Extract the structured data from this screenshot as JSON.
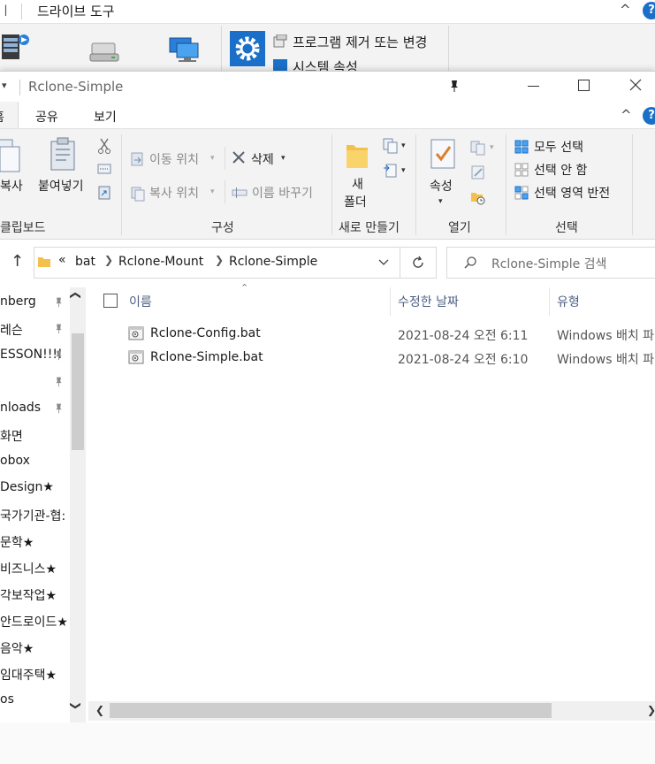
{
  "bg_window": {
    "partial_tab": "ㅣ",
    "tab_drive_tools": "드라이브 도구",
    "chevron": "^",
    "help": "?",
    "program_remove": "프로그램 제거 또는 변경",
    "system_props": "시스템 속성"
  },
  "window": {
    "title": "Rclone-Simple",
    "pin": "📌",
    "minimize": "—",
    "maximize": "☐",
    "close": "✕"
  },
  "menu": {
    "tab_home_partial": "홈",
    "tab_share": "공유",
    "tab_view": "보기",
    "collapse": "^",
    "help": "?"
  },
  "ribbon": {
    "paste_partial": "복사",
    "paste": "붙여넣기",
    "clipboard_label": "클립보드",
    "move_to": "이동 위치",
    "copy_to": "복사 위치",
    "delete": "삭제",
    "rename": "이름 바꾸기",
    "organize_label": "구성",
    "new_folder_line1": "새",
    "new_folder_line2": "폴더",
    "new_label": "새로 만들기",
    "properties": "속성",
    "open_label": "열기",
    "select_all": "모두 선택",
    "select_none": "선택 안 함",
    "invert_selection": "선택 영역 반전",
    "select_label": "선택"
  },
  "address": {
    "back": "↑",
    "overflow": "«",
    "crumbs": [
      "bat",
      "Rclone-Mount",
      "Rclone-Simple"
    ],
    "search_placeholder": "Rclone-Simple 검색"
  },
  "nav_items": [
    {
      "label": "nberg",
      "pinned": true
    },
    {
      "label": "레슨",
      "pinned": true
    },
    {
      "label": "ESSON!!!!",
      "pinned": true
    },
    {
      "label": "",
      "pinned": true
    },
    {
      "label": "nloads",
      "pinned": true
    },
    {
      "label": "화면",
      "pinned": false
    },
    {
      "label": "obox",
      "pinned": false
    },
    {
      "label": "Design★",
      "pinned": false
    },
    {
      "label": "국가기관-협:",
      "pinned": false
    },
    {
      "label": "문학★",
      "pinned": false
    },
    {
      "label": "비즈니스★",
      "pinned": false
    },
    {
      "label": "각보작업★",
      "pinned": false
    },
    {
      "label": "안드로이드★",
      "pinned": false
    },
    {
      "label": "음악★",
      "pinned": false
    },
    {
      "label": "임대주택★",
      "pinned": false
    },
    {
      "label": "os",
      "pinned": false
    }
  ],
  "columns": {
    "name": "이름",
    "modified": "수정한 날짜",
    "type": "유형"
  },
  "files": [
    {
      "name": "Rclone-Config.bat",
      "modified": "2021-08-24 오전 6:11",
      "type": "Windows 배치 파"
    },
    {
      "name": "Rclone-Simple.bat",
      "modified": "2021-08-24 오전 6:10",
      "type": "Windows 배치 파"
    }
  ],
  "colors": {
    "accent": "#0078d7",
    "folder": "#f3c14b",
    "header_text": "#4d6082"
  }
}
